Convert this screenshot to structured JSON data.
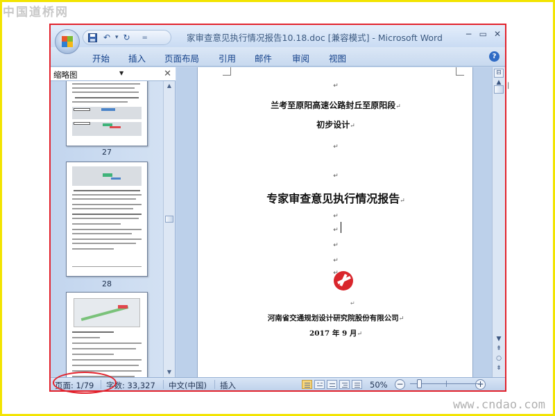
{
  "watermarks": {
    "top": "中国道桥网",
    "bottom": "www.cndao.com"
  },
  "window": {
    "title": "家审查意见执行情况报告10.18.doc [兼容模式] - Microsoft Word"
  },
  "quick_access": {
    "separator": "▾",
    "more": "="
  },
  "ribbon": {
    "tabs": [
      "开始",
      "插入",
      "页面布局",
      "引用",
      "邮件",
      "审阅",
      "视图"
    ]
  },
  "thumbnail_pane": {
    "title": "缩略图",
    "pages": [
      "27",
      "28"
    ]
  },
  "document": {
    "paragraph_mark": "↵",
    "line1": "兰考至原阳高速公路封丘至原阳段",
    "line2": "初步设计",
    "report_title": "专家审查意见执行情况报告",
    "org": "河南省交通规划设计研究院股份有限公司",
    "date": "2017 年 9 月"
  },
  "status_bar": {
    "page": "页面: 1/79",
    "word_count": "字数: 33,327",
    "language": "中文(中国)",
    "mode": "插入",
    "zoom": "50%",
    "zoom_level": 0.5
  },
  "colors": {
    "annotation": "#e2202a",
    "frame": "#f2e400",
    "window_bg": "#c7d8ee"
  }
}
